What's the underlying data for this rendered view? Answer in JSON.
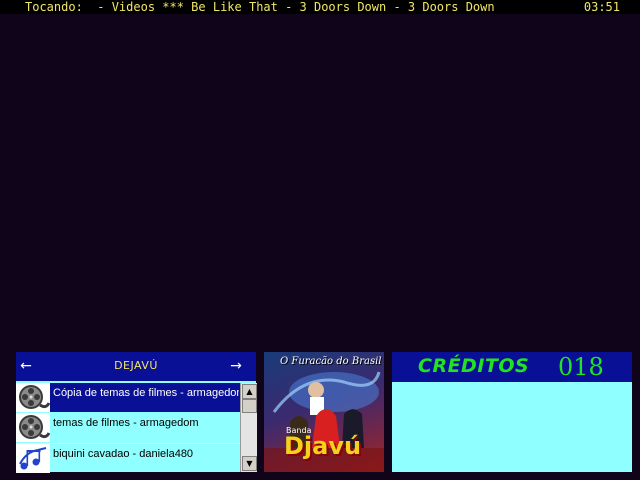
{
  "status": {
    "now_playing": "Tocando:  - Videos *** Be Like That - 3 Doors Down - 3 Doors Down",
    "clock": "03:51"
  },
  "browser": {
    "folder_title": "DEJAVÚ",
    "prev_arrow": "←",
    "next_arrow": "→",
    "items": [
      {
        "label": "Cópia de temas de filmes - armagedom",
        "icon": "film-reel-icon",
        "selected": true
      },
      {
        "label": "temas de filmes - armagedom",
        "icon": "film-reel-icon",
        "selected": false
      },
      {
        "label": "biquini cavadao - daniela480",
        "icon": "music-notes-icon",
        "selected": false
      }
    ],
    "scroll_up": "▲",
    "scroll_down": "▼"
  },
  "cover": {
    "title": "O Furacão do Brasil",
    "small": "Banda",
    "band": "Djavú"
  },
  "credits": {
    "label": "CRÉDITOS",
    "value": "018"
  },
  "colors": {
    "background": "#10041a",
    "panel_blue": "#0a1096",
    "panel_cyan": "#8fffff",
    "credits_green": "#22e322",
    "status_yellow": "#f2e56a"
  }
}
